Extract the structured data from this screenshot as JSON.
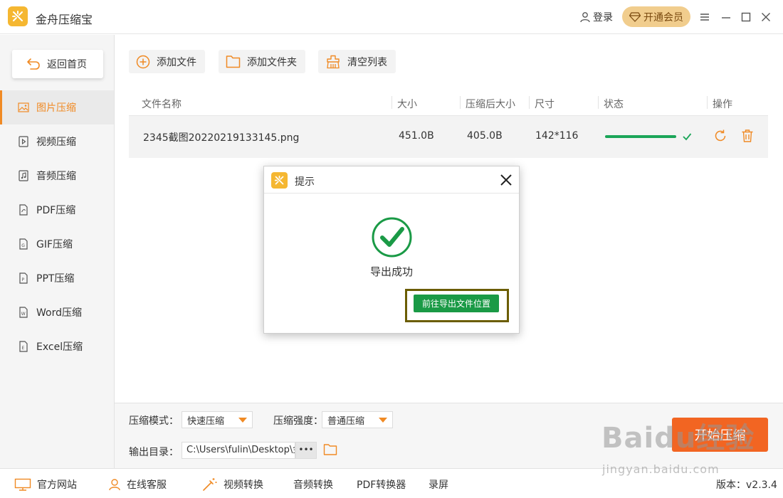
{
  "app": {
    "title": "金舟压缩宝",
    "login_label": "登录",
    "vip_label": "开通会员",
    "window_controls": [
      "menu-icon",
      "minimize-icon",
      "maximize-icon",
      "close-icon"
    ]
  },
  "sidebar": {
    "home_label": "返回首页",
    "items": [
      {
        "label": "图片压缩",
        "icon": "image-icon",
        "active": true
      },
      {
        "label": "视频压缩",
        "icon": "video-icon",
        "active": false
      },
      {
        "label": "音频压缩",
        "icon": "audio-icon",
        "active": false
      },
      {
        "label": "PDF压缩",
        "icon": "pdf-icon",
        "active": false
      },
      {
        "label": "GIF压缩",
        "icon": "gif-icon",
        "active": false
      },
      {
        "label": "PPT压缩",
        "icon": "ppt-icon",
        "active": false
      },
      {
        "label": "Word压缩",
        "icon": "word-icon",
        "active": false
      },
      {
        "label": "Excel压缩",
        "icon": "excel-icon",
        "active": false
      }
    ]
  },
  "toolbar": {
    "add_file": "添加文件",
    "add_folder": "添加文件夹",
    "clear_list": "清空列表"
  },
  "table": {
    "headers": [
      "文件名称",
      "大小",
      "压缩后大小",
      "尺寸",
      "状态",
      "操作"
    ],
    "rows": [
      {
        "name": "2345截图20220219133145.png",
        "size": "451.0B",
        "compressed_size": "405.0B",
        "dimensions": "142*116",
        "progress": 1.0,
        "status": "done"
      }
    ]
  },
  "options": {
    "mode_label": "压缩模式：",
    "mode_value": "快速压缩",
    "strength_label": "压缩强度：",
    "strength_value": "普通压缩",
    "output_label": "输出目录：",
    "output_path": "C:\\Users\\fulin\\Desktop\\金",
    "more_label": "•••",
    "start_label": "开始压缩"
  },
  "footer": {
    "website": "官方网站",
    "support": "在线客服",
    "video_convert": "视频转换",
    "audio_convert": "音频转换",
    "pdf_convert": "PDF转换器",
    "screen_record": "录屏",
    "version": "版本：v2.3.4"
  },
  "dialog": {
    "title": "提示",
    "message": "导出成功",
    "action_label": "前往导出文件位置"
  },
  "watermark": {
    "text": "Baidu经验",
    "sub": "jingyan.baidu.com"
  },
  "colors": {
    "accent": "#f08a24",
    "success": "#1aa558",
    "start_button": "#f26522",
    "vip": "#f1cd8d",
    "logo": "#f5b731"
  }
}
